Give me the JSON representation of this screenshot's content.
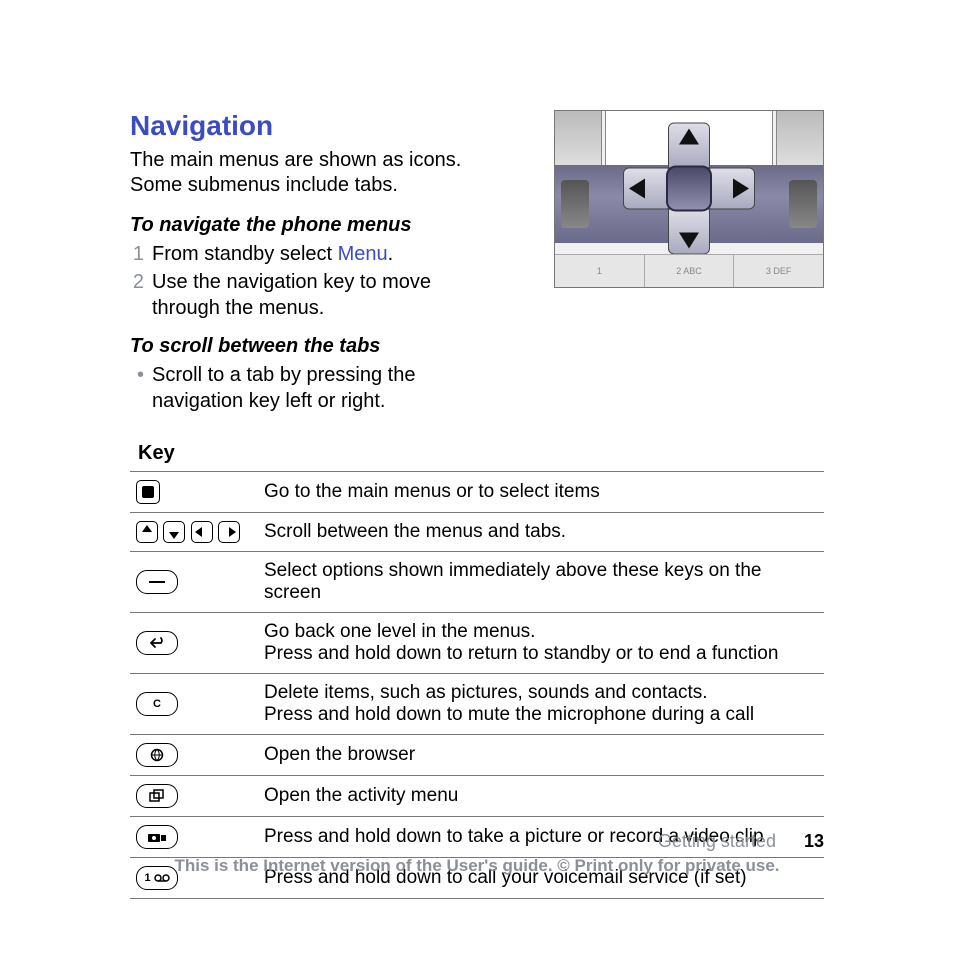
{
  "heading": "Navigation",
  "intro": "The main menus are shown as icons. Some submenus include tabs.",
  "section1_title": "To navigate the phone menus",
  "step1_marker": "1",
  "step1_prefix": "From standby select ",
  "step1_link": "Menu",
  "step1_suffix": ".",
  "step2_marker": "2",
  "step2_text": "Use the navigation key to move through the menus.",
  "section2_title": "To scroll between the tabs",
  "bullet_text": "Scroll to a tab by pressing the navigation key left or right.",
  "keypad": {
    "k1": "1",
    "k2": "2 ABC",
    "k3": "3 DEF"
  },
  "key_heading": "Key",
  "rows": {
    "r0": "Go to the main menus or to select items",
    "r1": "Scroll between the menus and tabs.",
    "r2": "Select options shown immediately above these keys on the screen",
    "r3": "Go back one level in the menus.\nPress and hold down to return to standby or to end a function",
    "r4": "Delete items, such as pictures, sounds and contacts.\nPress and hold down to mute the microphone during a call",
    "r5": "Open the browser",
    "r6": "Open the activity menu",
    "r7": "Press and hold down to take a picture or record a video clip",
    "r8": "Press and hold down to call your voicemail service (if set)"
  },
  "key_labels": {
    "c": "C",
    "one": "1"
  },
  "footer": {
    "section": "Getting started",
    "page": "13",
    "notice": "This is the Internet version of the User's guide. © Print only for private use."
  }
}
